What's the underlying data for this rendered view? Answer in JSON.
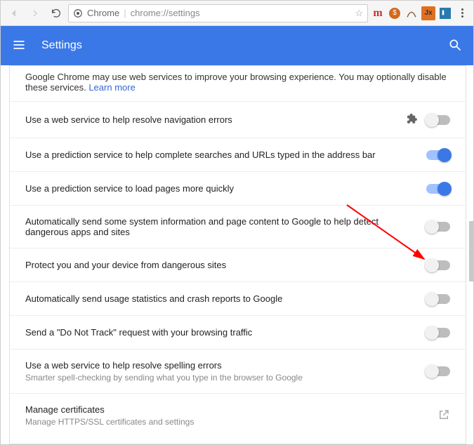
{
  "toolbar": {
    "omnibox_label": "Chrome",
    "url": "chrome://settings"
  },
  "header": {
    "title": "Settings"
  },
  "intro": {
    "text_before": "Google Chrome may use web services to improve your browsing experience. You may optionally disable these services. ",
    "learn_more": "Learn more"
  },
  "rows": [
    {
      "label": "Use a web service to help resolve navigation errors",
      "sub": "",
      "type": "toggle",
      "on": false,
      "extension_icon": true
    },
    {
      "label": "Use a prediction service to help complete searches and URLs typed in the address bar",
      "sub": "",
      "type": "toggle",
      "on": true
    },
    {
      "label": "Use a prediction service to load pages more quickly",
      "sub": "",
      "type": "toggle",
      "on": true
    },
    {
      "label": "Automatically send some system information and page content to Google to help detect dangerous apps and sites",
      "sub": "",
      "type": "toggle",
      "on": false
    },
    {
      "label": "Protect you and your device from dangerous sites",
      "sub": "",
      "type": "toggle",
      "on": false
    },
    {
      "label": "Automatically send usage statistics and crash reports to Google",
      "sub": "",
      "type": "toggle",
      "on": false
    },
    {
      "label": "Send a \"Do Not Track\" request with your browsing traffic",
      "sub": "",
      "type": "toggle",
      "on": false
    },
    {
      "label": "Use a web service to help resolve spelling errors",
      "sub": "Smarter spell-checking by sending what you type in the browser to Google",
      "type": "toggle",
      "on": false
    },
    {
      "label": "Manage certificates",
      "sub": "Manage HTTPS/SSL certificates and settings",
      "type": "link"
    }
  ]
}
